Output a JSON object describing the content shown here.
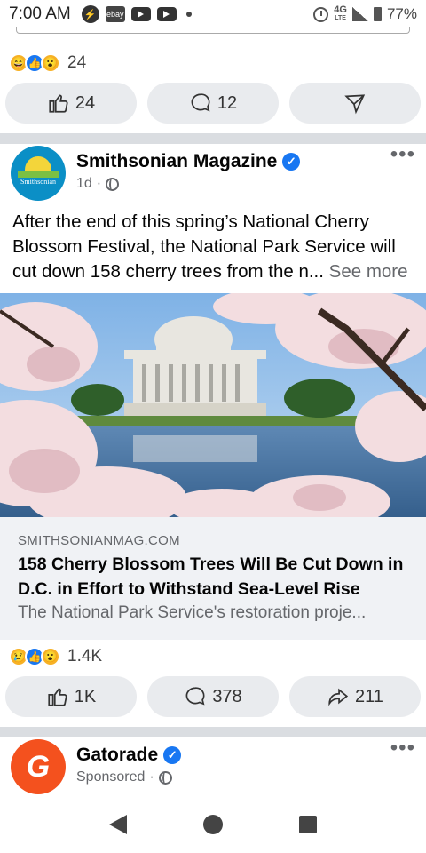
{
  "status_bar": {
    "time": "7:00 AM",
    "ebay_label": "ebay",
    "network": "4G",
    "network_sub": "LTE",
    "battery": "77%"
  },
  "prev_post": {
    "reaction_count": "24",
    "actions": {
      "like": "24",
      "comment": "12"
    }
  },
  "post1": {
    "name": "Smithsonian Magazine",
    "avatar_text": "Smithsonian",
    "time": "1d",
    "text": "After the end of this spring’s National Cherry Blossom Festival, the National Park Service will cut down 158 cherry trees from the n",
    "ellipsis": "...",
    "see_more": "See more",
    "link": {
      "domain": "SMITHSONIANMAG.COM",
      "title": "158 Cherry Blossom Trees Will Be Cut Down in D.C. in Effort to Withstand Sea-Level Rise",
      "description": "The National Park Service's restoration proje..."
    },
    "reaction_count": "1.4K",
    "actions": {
      "like": "1K",
      "comment": "378",
      "share": "211"
    }
  },
  "post2": {
    "name": "Gatorade",
    "avatar_letter": "G",
    "meta": "Sponsored"
  },
  "icons": [
    "messenger-icon",
    "ebay-icon",
    "youtube-icon",
    "alarm-icon",
    "signal-icon",
    "battery-icon",
    "like-icon",
    "comment-icon",
    "share-icon",
    "globe-icon",
    "verified-icon",
    "more-icon",
    "back-icon",
    "home-icon",
    "recents-icon"
  ],
  "colors": {
    "accent": "#1877f2",
    "button_bg": "#e9ebee",
    "divider": "#dadde1",
    "link_bg": "#f0f2f5",
    "gatorade": "#f4511e"
  }
}
